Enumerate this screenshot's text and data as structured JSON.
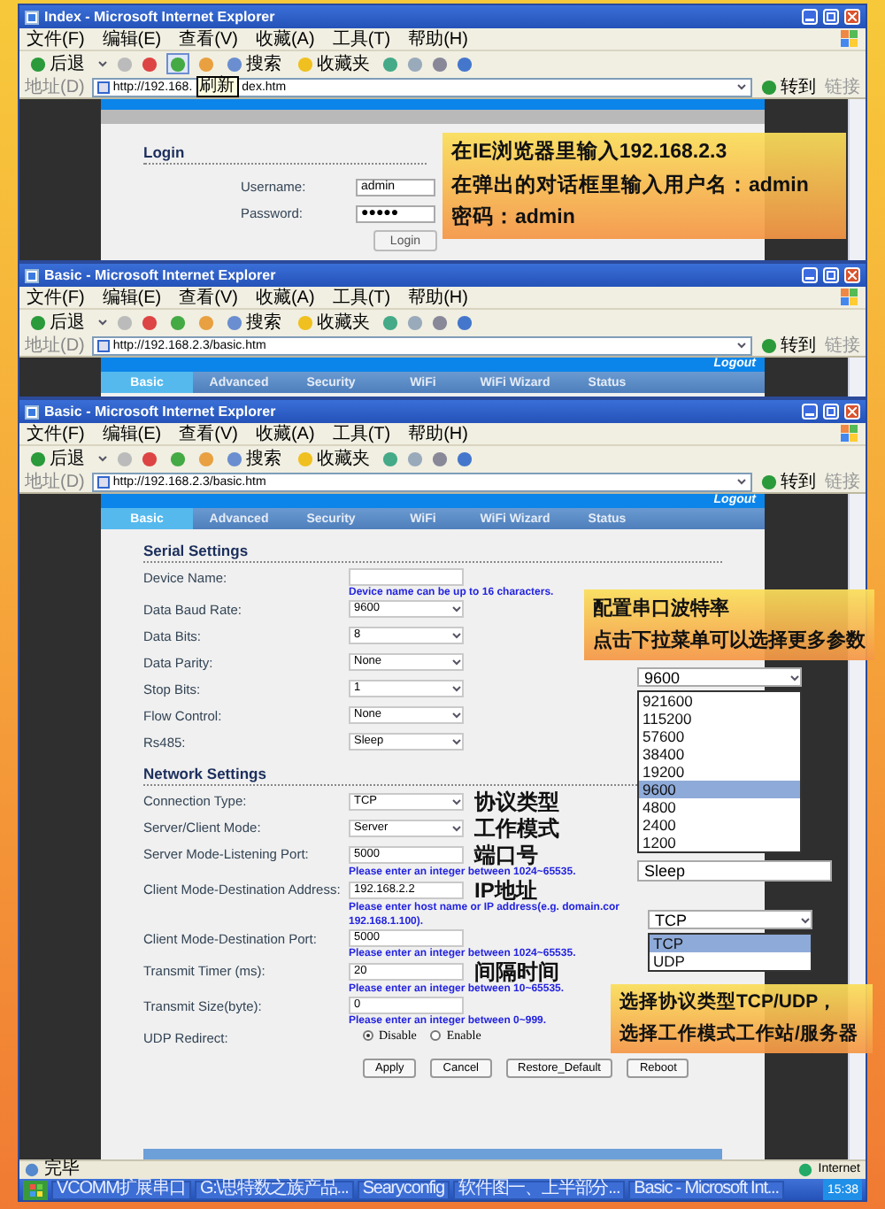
{
  "windows": [
    {
      "kind": "login",
      "title": "Index - Microsoft Internet Explorer",
      "menu": [
        "文件(F)",
        "编辑(E)",
        "查看(V)",
        "收藏(A)",
        "工具(T)",
        "帮助(H)"
      ],
      "toolbar": {
        "back": "后退",
        "search": "搜索",
        "favorites": "收藏夹"
      },
      "address_label": "地址(D)",
      "address": "http://192.168.",
      "tooltip": "刷新",
      "address_rest": "dex.htm",
      "go": "转到",
      "links": "链接",
      "page": {
        "heading": "Login",
        "fields": [
          {
            "label": "Username:",
            "value": "admin"
          },
          {
            "label": "Password:",
            "value": "●●●●●"
          }
        ],
        "button": "Login"
      }
    },
    {
      "kind": "basic",
      "title": "Basic - Microsoft Internet Explorer",
      "menu": [
        "文件(F)",
        "编辑(E)",
        "查看(V)",
        "收藏(A)",
        "工具(T)",
        "帮助(H)"
      ],
      "toolbar": {
        "back": "后退",
        "search": "搜索",
        "favorites": "收藏夹"
      },
      "address_label": "地址(D)",
      "address": "http://192.168.2.3/basic.htm",
      "go": "转到",
      "links": "链接",
      "page": {
        "logout": "Logout",
        "tabs": [
          {
            "label": "Basic",
            "selected": true
          },
          {
            "label": "Advanced",
            "selected": false
          },
          {
            "label": "Security",
            "selected": false
          },
          {
            "label": "WiFi",
            "selected": false
          },
          {
            "label": "WiFi Wizard",
            "selected": false
          },
          {
            "label": "Status",
            "selected": false
          }
        ]
      }
    },
    {
      "kind": "basic",
      "title": "Basic - Microsoft Internet Explorer",
      "menu": [
        "文件(F)",
        "编辑(E)",
        "查看(V)",
        "收藏(A)",
        "工具(T)",
        "帮助(H)"
      ],
      "toolbar": {
        "back": "后退",
        "search": "搜索",
        "favorites": "收藏夹"
      },
      "address_label": "地址(D)",
      "address": "http://192.168.2.3/basic.htm",
      "go": "转到",
      "links": "链接",
      "page": {
        "logout": "Logout",
        "tabs": [
          {
            "label": "Basic",
            "selected": true
          },
          {
            "label": "Advanced",
            "selected": false
          },
          {
            "label": "Security",
            "selected": false
          },
          {
            "label": "WiFi",
            "selected": false
          },
          {
            "label": "WiFi Wizard",
            "selected": false
          },
          {
            "label": "Status",
            "selected": false
          }
        ],
        "sections": [
          {
            "heading": "Serial Settings",
            "rows": [
              {
                "label": "Device Name:",
                "kind": "text",
                "hints": [
                  "Device name can be up to 16 characters."
                ]
              },
              {
                "label": "Data Baud Rate:",
                "kind": "select",
                "value": "9600"
              },
              {
                "label": "Data Bits:",
                "kind": "select",
                "value": "8"
              },
              {
                "label": "Data Parity:",
                "kind": "select",
                "value": "None"
              },
              {
                "label": "Stop Bits:",
                "kind": "select",
                "value": "1"
              },
              {
                "label": "Flow Control:",
                "kind": "select",
                "value": "None"
              },
              {
                "label": "Rs485:",
                "kind": "select",
                "value": "Sleep"
              }
            ]
          },
          {
            "heading": "Network Settings",
            "rows": [
              {
                "label": "Connection Type:",
                "kind": "select",
                "value": "TCP",
                "note": "协议类型"
              },
              {
                "label": "Server/Client Mode:",
                "kind": "select",
                "value": "Server",
                "note": "工作模式"
              },
              {
                "label": "Server Mode-Listening Port:",
                "kind": "text",
                "value": "5000",
                "note": "端口号",
                "hints": [
                  "Please enter an integer between 1024~65535."
                ]
              },
              {
                "label": "Client Mode-Destination Address:",
                "kind": "text",
                "value": "192.168.2.2",
                "note": "IP地址",
                "hints": [
                  "Please enter host name or IP address(e.g. domain.cor",
                  "192.168.1.100)."
                ]
              },
              {
                "label": "Client Mode-Destination Port:",
                "kind": "text",
                "value": "5000",
                "hints": [
                  "Please enter an integer between 1024~65535."
                ]
              },
              {
                "label": "Transmit Timer (ms):",
                "kind": "text",
                "value": "20",
                "note": "间隔时间",
                "hints": [
                  "Please enter an integer between 10~65535."
                ]
              },
              {
                "label": "Transmit Size(byte):",
                "kind": "text",
                "value": "0",
                "hints": [
                  "Please enter an integer between 0~999."
                ]
              },
              {
                "label": "UDP Redirect:",
                "kind": "radio",
                "options": [
                  {
                    "label": "Disable",
                    "selected": true
                  },
                  {
                    "label": "Enable",
                    "selected": false
                  }
                ]
              }
            ]
          }
        ],
        "buttons": [
          "Apply",
          "Cancel",
          "Restore_Default",
          "Reboot"
        ]
      }
    }
  ],
  "annotations": [
    {
      "lines": [
        "在IE浏览器里输入192.168.2.3",
        "在弹出的对话框里输入用户名：admin",
        "密码：admin"
      ]
    },
    {
      "lines": [
        "配置串口波特率",
        "点击下拉菜单可以选择更多参数"
      ]
    },
    {
      "lines": [
        "选择协议类型TCP/UDP，",
        "选择工作模式工作站/服务器"
      ]
    }
  ],
  "dropdowns": [
    {
      "value": "9600",
      "options": [
        {
          "label": "921600",
          "selected": false
        },
        {
          "label": "115200",
          "selected": false
        },
        {
          "label": "57600",
          "selected": false
        },
        {
          "label": "38400",
          "selected": false
        },
        {
          "label": "19200",
          "selected": false
        },
        {
          "label": "9600",
          "selected": true
        },
        {
          "label": "4800",
          "selected": false
        },
        {
          "label": "2400",
          "selected": false
        },
        {
          "label": "1200",
          "selected": false
        }
      ],
      "below": "Sleep"
    },
    {
      "value": "TCP",
      "options": [
        {
          "label": "TCP",
          "selected": true
        },
        {
          "label": "UDP",
          "selected": false
        }
      ]
    }
  ],
  "status_bar": {
    "text": "完毕",
    "zone": "Internet"
  },
  "taskbar": {
    "items": [
      "VCOMM扩展串口",
      "G:\\思特数之族产品...",
      "Searyconfig",
      "软件图一、上半部分...",
      "Basic - Microsoft Int..."
    ],
    "clock": "15:38"
  }
}
